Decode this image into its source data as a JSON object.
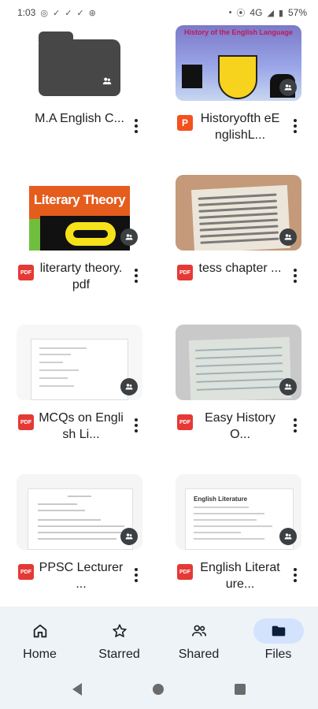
{
  "status_bar": {
    "time": "1:03",
    "network": "4G",
    "battery": "57%",
    "left_icons": [
      "whatsapp-icon",
      "download-done-icon",
      "download-done-icon",
      "download-done-icon",
      "vpn-icon"
    ],
    "right_icons": [
      "dot-icon",
      "vibrate-icon",
      "signal-icon",
      "battery-icon"
    ]
  },
  "files": [
    {
      "name": "M.A English C...",
      "type": "folder",
      "shared": true
    },
    {
      "name": "Historyofth eEnglishL...",
      "type": "ppt",
      "icon_label": "P",
      "shared": true,
      "thumb_text": "History of the English Language"
    },
    {
      "name": "literarty theory.pdf",
      "type": "pdf",
      "icon_label": "PDF",
      "shared": true,
      "thumb_text": "Literary Theory"
    },
    {
      "name": "tess chapter ...",
      "type": "pdf",
      "icon_label": "PDF",
      "shared": true
    },
    {
      "name": "MCQs on English Li...",
      "type": "pdf",
      "icon_label": "PDF",
      "shared": true
    },
    {
      "name": "Easy History O...",
      "type": "pdf",
      "icon_label": "PDF",
      "shared": true
    },
    {
      "name": "PPSC Lecturer ...",
      "type": "pdf",
      "icon_label": "PDF",
      "shared": true
    },
    {
      "name": "English Literature...",
      "type": "pdf",
      "icon_label": "PDF",
      "shared": true,
      "thumb_text": "English Literature"
    }
  ],
  "bottom_nav": {
    "items": [
      {
        "label": "Home",
        "icon": "home-icon",
        "active": false
      },
      {
        "label": "Starred",
        "icon": "star-icon",
        "active": false
      },
      {
        "label": "Shared",
        "icon": "shared-people-icon",
        "active": false
      },
      {
        "label": "Files",
        "icon": "folder-icon",
        "active": true
      }
    ]
  },
  "colors": {
    "nav_background": "#eef3f8",
    "active_pill": "#d3e3fd",
    "pdf_red": "#e53935",
    "ppt_orange": "#f4511e",
    "folder_gray": "#474747"
  }
}
